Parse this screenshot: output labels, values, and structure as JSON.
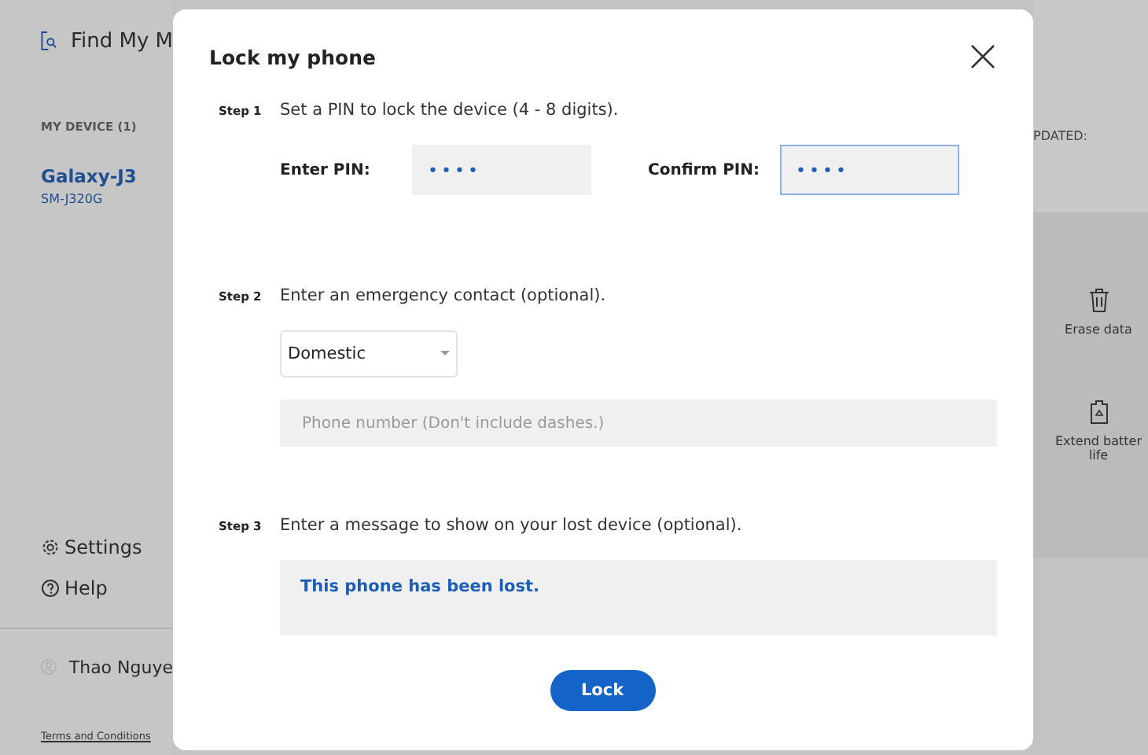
{
  "sidebar": {
    "app_title": "Find My M",
    "section_label": "MY DEVICE (1)",
    "device": {
      "name": "Galaxy-J3",
      "model": "SM-J320G",
      "selected": true
    },
    "links": [
      {
        "kind": "settings",
        "label": "Settings"
      },
      {
        "kind": "help",
        "label": "Help"
      }
    ],
    "account_name": "Thao Nguye",
    "footer_link": "Terms and Conditions"
  },
  "right_panel": {
    "updated_label": "PDATED:",
    "actions": [
      {
        "kind": "erase",
        "label": "Erase data"
      },
      {
        "kind": "battery",
        "label": "Extend batter life"
      }
    ]
  },
  "dialog": {
    "title": "Lock my phone",
    "steps": [
      {
        "label": "Step 1",
        "text": "Set a PIN to lock the device (4 - 8 digits).",
        "kind": "pin",
        "fields": [
          {
            "label": "Enter PIN:",
            "value": "••••",
            "focused": false
          },
          {
            "label": "Confirm PIN:",
            "value": "••••",
            "focused": true
          }
        ]
      },
      {
        "label": "Step 2",
        "text": "Enter an emergency contact (optional).",
        "kind": "contact",
        "dropdown": "Domestic",
        "placeholder": "Phone number (Don't include dashes.)"
      },
      {
        "label": "Step 3",
        "text": "Enter a message to show on your lost device (optional).",
        "kind": "message",
        "value": "This phone has been lost."
      }
    ],
    "button": "Lock"
  }
}
